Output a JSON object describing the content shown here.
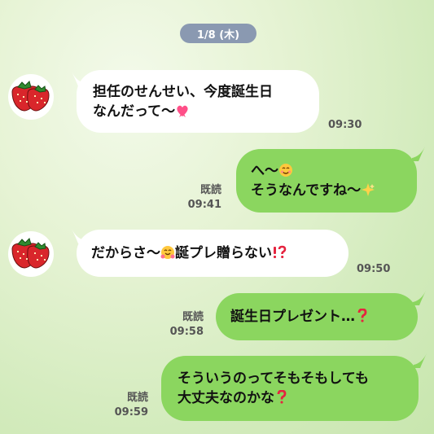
{
  "date_label": "1/8 (木)",
  "read_label": "既読",
  "messages": [
    {
      "lines": [
        "担任のせんせい、今度誕生日",
        "なんだって〜"
      ],
      "time": "09:30"
    },
    {
      "lines": [
        "へ〜",
        "そうなんですね〜"
      ],
      "time": "09:41"
    },
    {
      "lines": [
        "だからさ〜",
        "誕プレ贈らない"
      ],
      "time": "09:50"
    },
    {
      "lines": [
        "誕生日プレゼント…"
      ],
      "time": "09:58"
    },
    {
      "lines": [
        "そういうのってそもそもしても",
        "大丈夫なのかな"
      ],
      "time": "09:59"
    }
  ],
  "colors": {
    "outgoing_bubble": "#8bd65f",
    "incoming_bubble": "#ffffff",
    "date_pill": "#8a99b1"
  },
  "icons": [
    "strawberry-avatar",
    "heart-ribbon-icon",
    "smile-face-icon",
    "sparkle-icon",
    "hug-face-icon",
    "exclamation-question-icon",
    "question-icon"
  ]
}
